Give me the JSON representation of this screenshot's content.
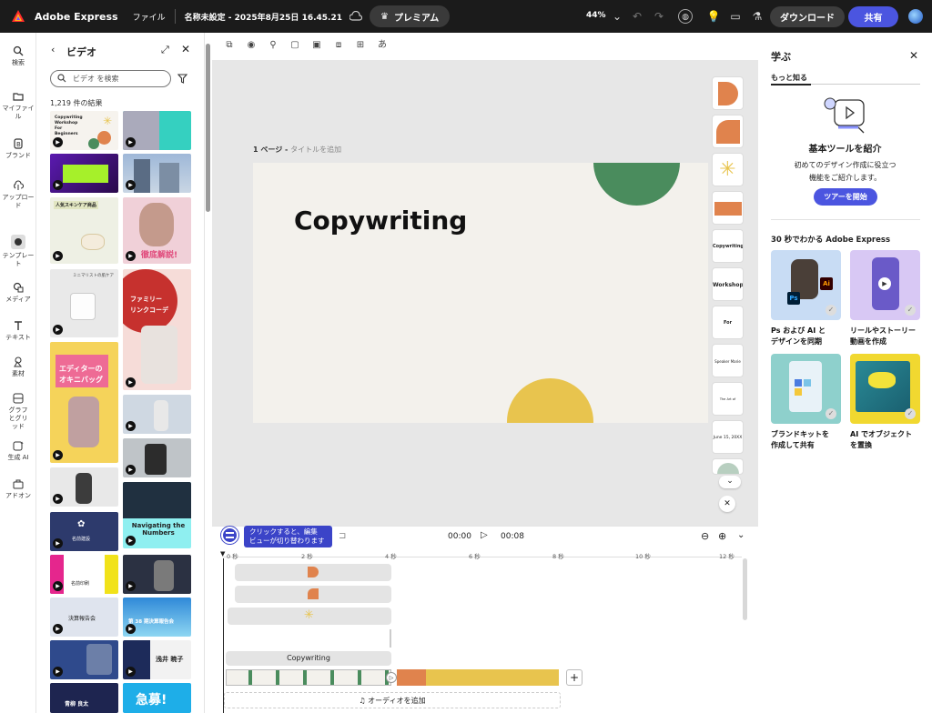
{
  "topbar": {
    "app_name": "Adobe Express",
    "menu_file": "ファイル",
    "doc_title": "名称未設定 - 2025年8月25日 16.45.21",
    "premium_label": "プレミアム",
    "zoom": "44%",
    "download_label": "ダウンロード",
    "share_label": "共有"
  },
  "rail": {
    "items": [
      {
        "label": "検索",
        "icon": "search-icon"
      },
      {
        "label": "マイファイル",
        "icon": "folder-icon"
      },
      {
        "label": "ブランド",
        "icon": "brand-icon"
      },
      {
        "label": "アップロード",
        "icon": "upload-icon"
      },
      {
        "label": "テンプレート",
        "icon": "template-icon"
      },
      {
        "label": "メディア",
        "icon": "media-icon"
      },
      {
        "label": "テキスト",
        "icon": "text-icon"
      },
      {
        "label": "素材",
        "icon": "elements-icon"
      },
      {
        "label": "グラフとグリッド",
        "icon": "grid-icon"
      },
      {
        "label": "生成 AI",
        "icon": "ai-icon"
      },
      {
        "label": "アドオン",
        "icon": "addon-icon"
      }
    ]
  },
  "video_panel": {
    "title": "ビデオ",
    "search_placeholder": "ビデオ を検索",
    "results": "1,219 件の結果",
    "thumbs": {
      "t1": "Copywriting Workshop For Beginners",
      "t3": "人気スキンケア商品",
      "t4": "徹底解説!",
      "t5": "ミニマリストの肌ケア",
      "t6a": "ファミリー",
      "t6b": "リンクコーデ",
      "t7a": "エディターの",
      "t7b": "オキニバッグ",
      "t8": "名前建設",
      "t9": "Navigating the Numbers",
      "t10": "名前印刷",
      "t11": "決算報告会",
      "t12": "第 38 期決算報告会",
      "t13": "浅井 暁子",
      "t14": "青柳 良太",
      "t15": "急募!"
    }
  },
  "canvas": {
    "page_label": "1 ページ - ",
    "page_title_placeholder": "タイトルを追加",
    "heading": "Copywriting"
  },
  "components": [
    "Copywriting",
    "Workshop",
    "For Beginners",
    "Speaker Marie Cor",
    "The Art of Persuasion",
    "June 15, 20XX"
  ],
  "learn_panel": {
    "title": "学ぶ",
    "tab": "もっと知る",
    "tool_heading": "基本ツールを紹介",
    "tool_desc1": "初めてのデザイン作成に役立つ",
    "tool_desc2": "機能をご紹介します。",
    "tour_button": "ツアーを開始",
    "section_title": "30 秒でわかる Adobe Express",
    "cards": [
      {
        "line1": "Ps および AI と",
        "line2": "デザインを同期"
      },
      {
        "line1": "リールやストーリー",
        "line2": "動画を作成"
      },
      {
        "line1": "ブランドキットを",
        "line2": "作成して共有"
      },
      {
        "line1": "AI でオブジェクト",
        "line2": "を置換"
      }
    ]
  },
  "timeline": {
    "tooltip_line1": "クリックすると、編集",
    "tooltip_line2": "ビューが切り替わります",
    "time_current": "00:00",
    "time_total": "00:08",
    "ticks": [
      "0 秒",
      "2 秒",
      "4 秒",
      "6 秒",
      "8 秒",
      "10 秒",
      "12 秒"
    ],
    "track_text": "Copywriting",
    "add_audio": "オーディオを追加"
  },
  "colors": {
    "accent": "#4b55e0",
    "green": "#4a8c5d",
    "yellow": "#e8c44e",
    "orange": "#e0834d"
  }
}
